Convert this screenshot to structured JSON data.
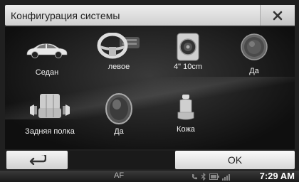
{
  "header": {
    "title": "Конфигурация системы",
    "close_icon": "close-icon"
  },
  "items": [
    {
      "label": "Седан",
      "icon": "car-sedan-icon"
    },
    {
      "label": "левое",
      "icon": "steering-wheel-icon"
    },
    {
      "label": "4\" 10cm",
      "icon": "speaker-4inch-icon"
    },
    {
      "label": "Да",
      "icon": "speaker-grille-icon"
    },
    {
      "label": "Задняя полка",
      "icon": "rear-shelf-speakers-icon"
    },
    {
      "label": "Да",
      "icon": "subwoofer-icon"
    },
    {
      "label": "Кожа",
      "icon": "leather-seat-icon"
    }
  ],
  "footer": {
    "back_icon": "back-arrow-icon",
    "ok_label": "OK"
  },
  "status": {
    "af": "AF",
    "time": "7:29 AM",
    "icons": [
      "phone-icon",
      "bluetooth-icon",
      "battery-icon",
      "signal-icon"
    ]
  }
}
